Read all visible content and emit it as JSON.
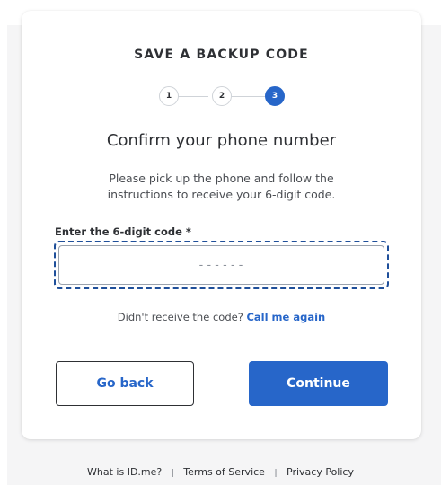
{
  "header": {
    "title": "SAVE A BACKUP CODE"
  },
  "stepper": {
    "steps": [
      {
        "label": "1",
        "active": false
      },
      {
        "label": "2",
        "active": false
      },
      {
        "label": "3",
        "active": true
      }
    ],
    "current_step": 3
  },
  "main": {
    "subtitle": "Confirm your phone number",
    "instructions": "Please pick up the phone and follow the instructions to receive your 6-digit code.",
    "code_field": {
      "label": "Enter the 6-digit code *",
      "value": "",
      "placeholder": "------"
    },
    "resend": {
      "prompt": "Didn't receive the code?",
      "link_label": "Call me again"
    }
  },
  "actions": {
    "back_label": "Go back",
    "continue_label": "Continue"
  },
  "footer": {
    "links": [
      "What is ID.me?",
      "Terms of Service",
      "Privacy Policy"
    ],
    "separator": "|"
  },
  "colors": {
    "accent": "#2766c9",
    "focus_ring": "#1f4f9a",
    "text": "#2e3034",
    "background": "#f5f5f6"
  }
}
